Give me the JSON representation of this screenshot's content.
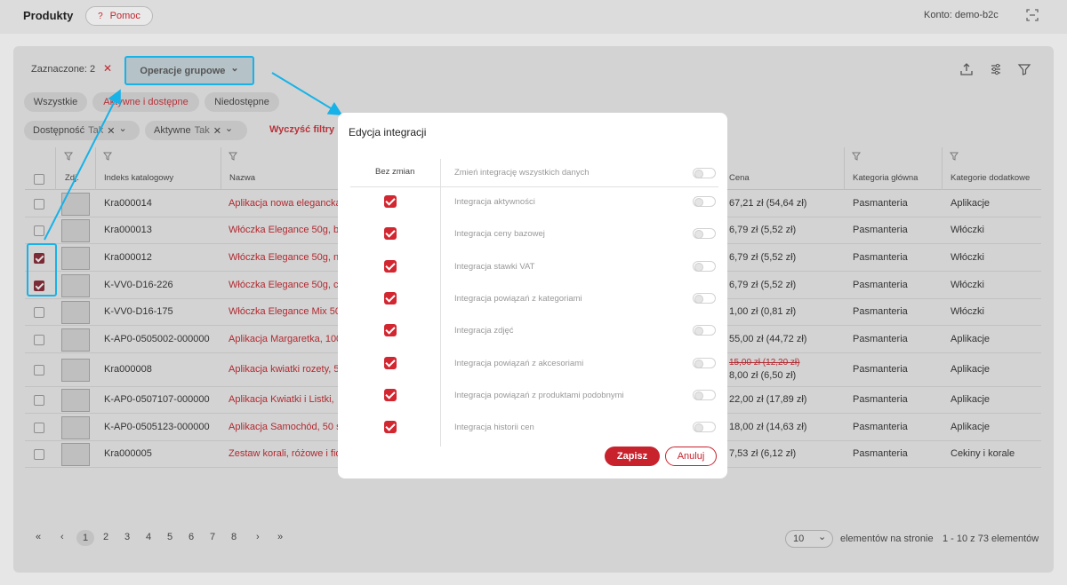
{
  "header": {
    "title": "Produkty",
    "help_label": "Pomoc",
    "help_icon": "?",
    "account": "Konto: demo-b2c"
  },
  "toolbar": {
    "selected_label": "Zaznaczone: 2",
    "clear_selected": "✕",
    "group_ops_label": "Operacje grupowe",
    "chevron": "⌄"
  },
  "tabs": [
    {
      "label": "Wszystkie"
    },
    {
      "label": "Aktywne i dostępne"
    },
    {
      "label": "Niedostępne"
    }
  ],
  "filters": [
    {
      "label": "Dostępność",
      "value": "Tak"
    },
    {
      "label": "Aktywne",
      "value": "Tak"
    }
  ],
  "clear_filters_label": "Wyczyść filtry",
  "filter_chip_x": "✕",
  "filter_chip_chevron": "⌄",
  "table": {
    "headers": [
      "Zdj.",
      "Indeks katalogowy",
      "Nazwa",
      "Cena",
      "Kategoria główna",
      "Kategorie dodatkowe"
    ],
    "rows": [
      {
        "index": "Kra000014",
        "name": "Aplikacja nowa elegancka",
        "price": "67,21 zł (54,64 zł)",
        "price_old": "",
        "category": "Pasmanteria",
        "extra": "Aplikacje",
        "checked": false
      },
      {
        "index": "Kra000013",
        "name": "Włóczka Elegance 50g, b",
        "price": "6,79 zł (5,52 zł)",
        "price_old": "",
        "category": "Pasmanteria",
        "extra": "Włóczki",
        "checked": false
      },
      {
        "index": "Kra000012",
        "name": "Włóczka Elegance 50g, n",
        "price": "6,79 zł (5,52 zł)",
        "price_old": "",
        "category": "Pasmanteria",
        "extra": "Włóczki",
        "checked": true
      },
      {
        "index": "K-VV0-D16-226",
        "name": "Włóczka Elegance 50g, c",
        "price": "6,79 zł (5,52 zł)",
        "price_old": "",
        "category": "Pasmanteria",
        "extra": "Włóczki",
        "checked": true
      },
      {
        "index": "K-VV0-D16-175",
        "name": "Włóczka Elegance Mix 50",
        "price": "1,00 zł (0,81 zł)",
        "price_old": "",
        "category": "Pasmanteria",
        "extra": "Włóczki",
        "checked": false
      },
      {
        "index": "K-AP0-0505002-000000",
        "name": "Aplikacja Margaretka, 100",
        "price": "55,00 zł (44,72 zł)",
        "price_old": "",
        "category": "Pasmanteria",
        "extra": "Aplikacje",
        "checked": false
      },
      {
        "index": "Kra000008",
        "name": "Aplikacja kwiatki rozety, 5",
        "price": "8,00 zł (6,50 zł)",
        "price_old": "15,00 zł (12,20 zł)",
        "category": "Pasmanteria",
        "extra": "Aplikacje",
        "checked": false
      },
      {
        "index": "K-AP0-0507107-000000",
        "name": "Aplikacja Kwiatki i Listki,",
        "price": "22,00 zł (17,89 zł)",
        "price_old": "",
        "category": "Pasmanteria",
        "extra": "Aplikacje",
        "checked": false
      },
      {
        "index": "K-AP0-0505123-000000",
        "name": "Aplikacja Samochód, 50 s",
        "price": "18,00 zł (14,63 zł)",
        "price_old": "",
        "category": "Pasmanteria",
        "extra": "Aplikacje",
        "checked": false
      },
      {
        "index": "Kra000005",
        "name": "Zestaw korali, różowe i fio",
        "price": "7,53 zł (6,12 zł)",
        "price_old": "",
        "category": "Pasmanteria",
        "extra": "Cekiny i korale",
        "checked": false
      }
    ]
  },
  "pagination": {
    "first": "«",
    "prev": "‹",
    "pages": [
      "1",
      "2",
      "3",
      "4",
      "5",
      "6",
      "7",
      "8"
    ],
    "next": "›",
    "last": "»",
    "per_page": "10",
    "per_page_label": "elementów na stronie",
    "total": "1 - 10 z 73 elementów"
  },
  "modal": {
    "title": "Edycja integracji",
    "col_left": "Bez zmian",
    "header_row": "Zmień integrację wszystkich danych",
    "items": [
      "Integracja aktywności",
      "Integracja ceny bazowej",
      "Integracja stawki VAT",
      "Integracja powiązań z kategoriami",
      "Integracja zdjęć",
      "Integracja powiązań z akcesoriami",
      "Integracja powiązań z produktami podobnymi",
      "Integracja historii cen"
    ],
    "save_label": "Zapisz",
    "cancel_label": "Anuluj"
  },
  "colors": {
    "accent": "#c8222d",
    "highlight": "#17b2e8"
  }
}
